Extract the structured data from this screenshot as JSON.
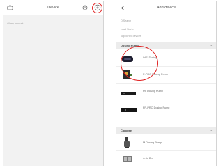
{
  "left_screen": {
    "title": "Device",
    "empty_text": "All my account"
  },
  "right_screen": {
    "title": "Add device",
    "search_placeholder": "Q Search",
    "menu": [
      "Load Stories",
      "Supported devices"
    ],
    "sections": [
      {
        "label": "Dosing Pump",
        "devices": [
          "WiFi Dosing",
          "P-PRO Dosing Pump",
          "PE Dosing Pump",
          "FR-PRO Dosing Pump"
        ]
      },
      {
        "label": "Carousel",
        "devices": [
          "M Dosing Pump",
          "Auto Pro"
        ]
      }
    ]
  },
  "colors": {
    "highlight": "#e02020",
    "background": "#f2f2f2",
    "section_bg": "#ececec"
  }
}
